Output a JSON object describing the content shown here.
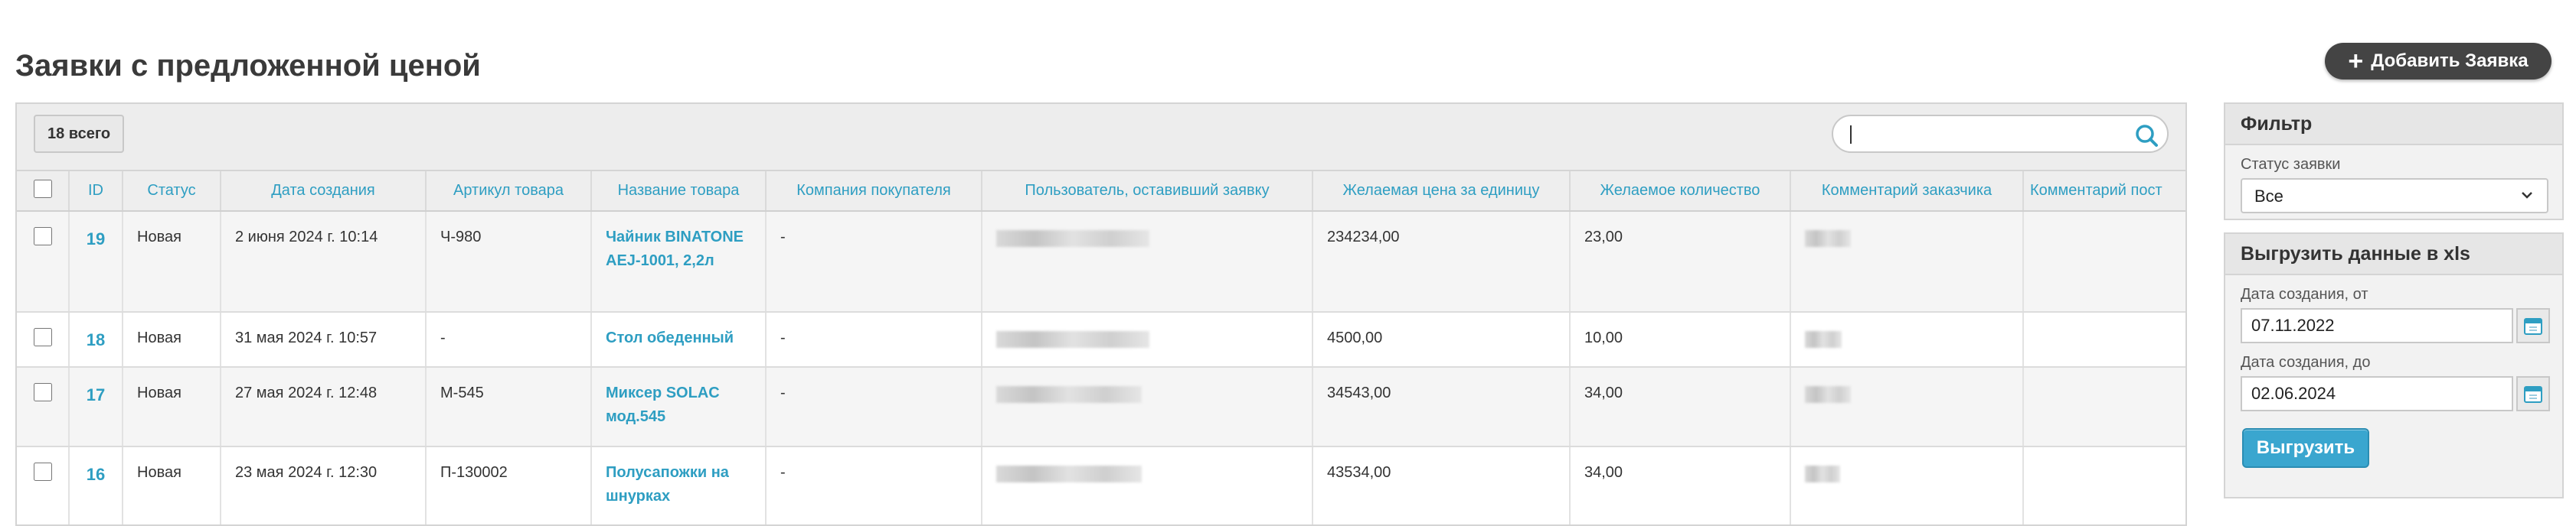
{
  "page": {
    "title": "Заявки с предложенной ценой",
    "add_button": "Добавить Заявка"
  },
  "table": {
    "count_label": "18 всего",
    "search_value": "",
    "columns": [
      "ID",
      "Статус",
      "Дата создания",
      "Артикул товара",
      "Название товара",
      "Компания покупателя",
      "Пользователь, оставивший заявку",
      "Желаемая цена за единицу",
      "Желаемое количество",
      "Комментарий заказчика",
      "Комментарий пост"
    ],
    "rows": [
      {
        "id": "19",
        "status": "Новая",
        "created": "2 июня 2024 г. 10:14",
        "sku": "Ч-980",
        "name": "Чайник BINATONE AEJ-1001, 2,2л",
        "company": "-",
        "price": "234234,00",
        "qty": "23,00"
      },
      {
        "id": "18",
        "status": "Новая",
        "created": "31 мая 2024 г. 10:57",
        "sku": "-",
        "name": "Стол обеденный",
        "company": "-",
        "price": "4500,00",
        "qty": "10,00"
      },
      {
        "id": "17",
        "status": "Новая",
        "created": "27 мая 2024 г. 12:48",
        "sku": "М-545",
        "name": "Миксер SOLAC мод.545",
        "company": "-",
        "price": "34543,00",
        "qty": "34,00"
      },
      {
        "id": "16",
        "status": "Новая",
        "created": "23 мая 2024 г. 12:30",
        "sku": "П-130002",
        "name": "Полусапожки на шнурках",
        "company": "-",
        "price": "43534,00",
        "qty": "34,00"
      }
    ]
  },
  "sidebar": {
    "filter_title": "Фильтр",
    "status_label": "Статус заявки",
    "status_value": "Все",
    "export_title": "Выгрузить данные в xls",
    "date_from_label": "Дата создания, от",
    "date_from": "07.11.2022",
    "date_to_label": "Дата создания, до",
    "date_to": "02.06.2024",
    "export_button": "Выгрузить"
  },
  "colors": {
    "accent": "#2e9ec2",
    "button_dark": "#444444",
    "export_button": "#3aa6cf"
  }
}
